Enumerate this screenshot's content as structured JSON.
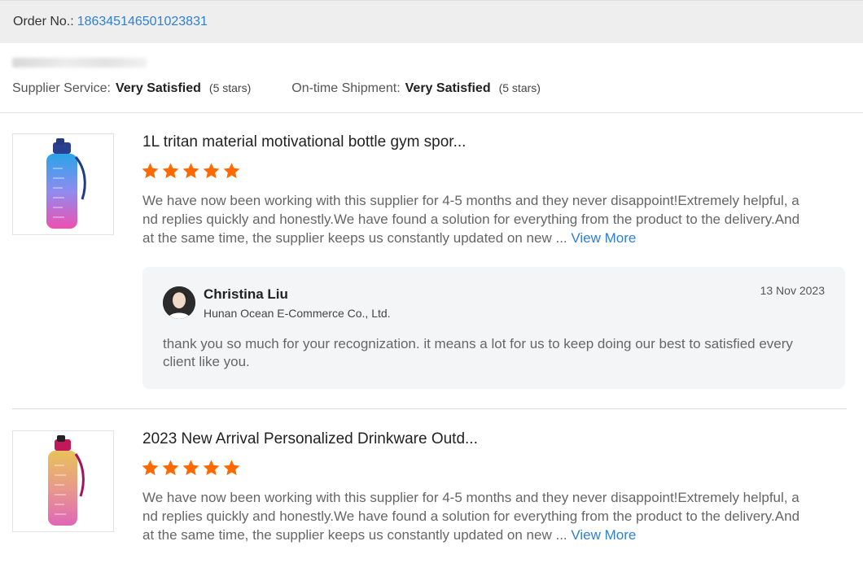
{
  "order": {
    "label": "Order No.:",
    "number": "186345146501023831"
  },
  "ratings": {
    "supplier_service_label": "Supplier Service:",
    "supplier_service_value": "Very Satisfied",
    "supplier_service_stars": "(5 stars)",
    "shipment_label": "On-time Shipment:",
    "shipment_value": "Very Satisfied",
    "shipment_stars": "(5 stars)"
  },
  "colors": {
    "accent_link": "#2f7fd1",
    "star": "#ff6a00",
    "reply_bg": "#f4f5f7"
  },
  "reviews": [
    {
      "product_title": "1L tritan material motivational bottle gym spor...",
      "rating": 5,
      "text": "We have now been working with this supplier for 4-5 months and they never disappoint!Extremely helpful, and replies quickly and honestly.We have found a solution for everything from the product to the delivery.And at the same time, the supplier keeps us constantly updated on new ...",
      "view_more": "View More",
      "reply": {
        "name": "Christina Liu",
        "company": "Hunan Ocean E-Commerce Co., Ltd.",
        "date": "13 Nov 2023",
        "text": "thank you so much for  your recognization. it means a lot for us to keep doing our best to satisfied every client like you."
      }
    },
    {
      "product_title": "2023 New Arrival Personalized Drinkware Outd...",
      "rating": 5,
      "text": "We have now been working with this supplier for 4-5 months and they never disappoint!Extremely helpful, and replies quickly and honestly.We have found a solution for everything from the product to the delivery.And at the same time, the supplier keeps us constantly updated on new ...",
      "view_more": "View More"
    }
  ]
}
